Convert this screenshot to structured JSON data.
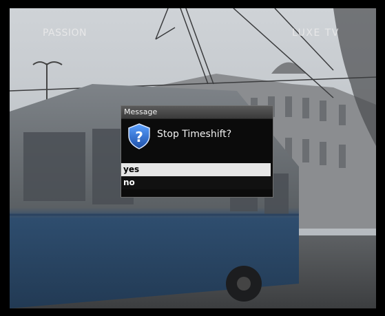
{
  "channel": {
    "left_label": "PASSION",
    "right_label": "LUXE TV"
  },
  "dialog": {
    "title": "Message",
    "icon": "question-shield-icon",
    "question": "Stop Timeshift?",
    "options": [
      {
        "label": "yes",
        "selected": true
      },
      {
        "label": "no",
        "selected": false
      }
    ]
  },
  "colors": {
    "selection_bg": "#e6e6e6",
    "dialog_bg": "#0b0b0b",
    "icon_blue": "#1f5fbf"
  }
}
